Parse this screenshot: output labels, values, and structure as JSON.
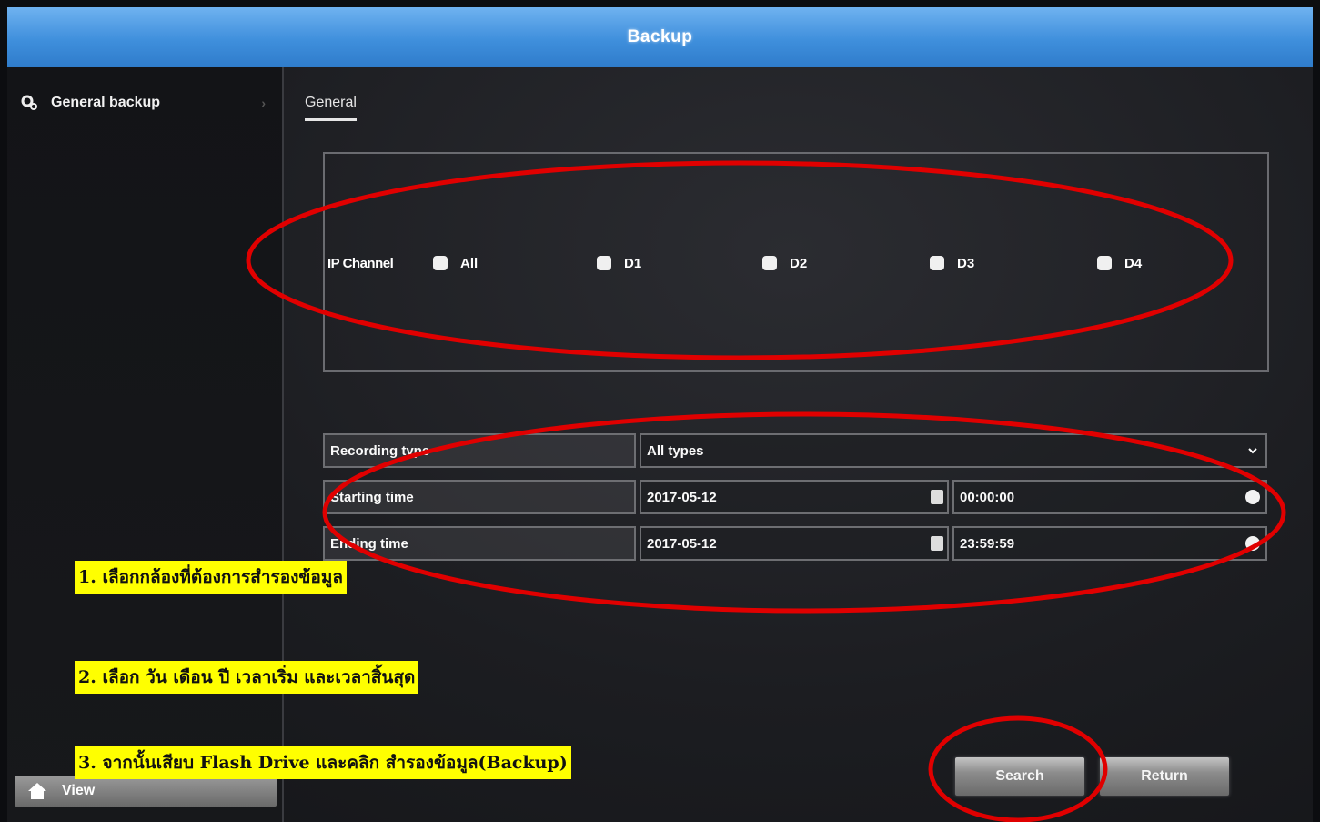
{
  "window": {
    "title": "Backup"
  },
  "sidebar": {
    "items": [
      {
        "label": "General backup",
        "icon": "gear-icon"
      }
    ],
    "view_label": "View"
  },
  "tabs": [
    {
      "label": "General",
      "active": true
    }
  ],
  "channels": {
    "label": "IP Channel",
    "options": [
      {
        "label": "All",
        "checked": false
      },
      {
        "label": "D1",
        "checked": false
      },
      {
        "label": "D2",
        "checked": false
      },
      {
        "label": "D3",
        "checked": false
      },
      {
        "label": "D4",
        "checked": false
      }
    ]
  },
  "form": {
    "recording_type": {
      "label": "Recording type",
      "value": "All types"
    },
    "start": {
      "label": "Starting time",
      "date": "2017-05-12",
      "time": "00:00:00"
    },
    "end": {
      "label": "Ending time",
      "date": "2017-05-12",
      "time": "23:59:59"
    }
  },
  "buttons": {
    "search": "Search",
    "return": "Return"
  },
  "annotations": {
    "step1": "1. เลือกกล้องที่ต้องการสำรองข้อมูล",
    "step2": "2. เลือก วัน เดือน ปี เวลาเริ่ม และเวลาสิ้นสุด",
    "step3": "3. จากนั้นเสียบ Flash Drive และคลิก สำรองข้อมูล(Backup)",
    "highlight_color": "#ffff00",
    "circle_color": "#e00000"
  },
  "colors": {
    "title_bar": "#3f8fdc",
    "background": "#1c1d21"
  }
}
